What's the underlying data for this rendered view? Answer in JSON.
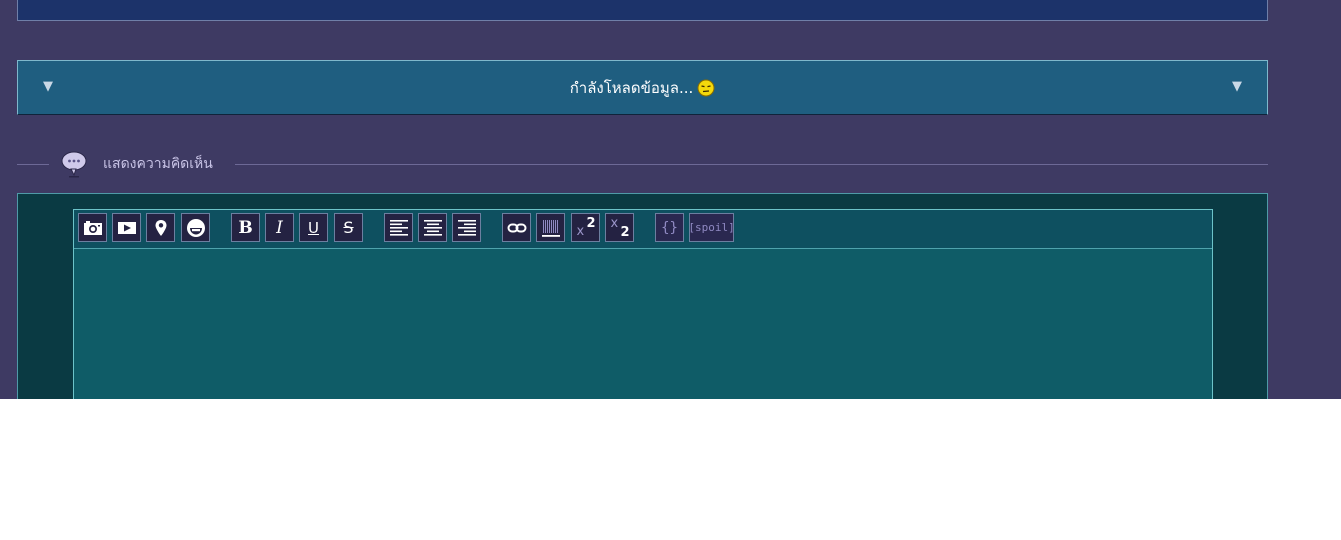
{
  "loading": {
    "text": "กำลังโหลดข้อมูล...",
    "arrow_left": "▼",
    "arrow_right": "▼",
    "icon": "sad-face-emoji-icon"
  },
  "comment": {
    "header_label": "แสดงความคิดเห็น",
    "icon": "speech-bubble-icon"
  },
  "toolbar": {
    "buttons": [
      {
        "name": "insert-image",
        "icon": "camera-icon"
      },
      {
        "name": "insert-video",
        "icon": "video-play-icon"
      },
      {
        "name": "insert-map",
        "icon": "map-pin-icon"
      },
      {
        "name": "insert-emoji",
        "icon": "smiley-icon"
      },
      {
        "name": "bold",
        "label": "B"
      },
      {
        "name": "italic",
        "label": "I"
      },
      {
        "name": "underline",
        "label": "U"
      },
      {
        "name": "strikethrough",
        "label": "S"
      },
      {
        "name": "align-left",
        "icon": "align-left-icon"
      },
      {
        "name": "align-center",
        "icon": "align-center-icon"
      },
      {
        "name": "align-right",
        "icon": "align-right-icon"
      },
      {
        "name": "insert-link",
        "icon": "link-icon"
      },
      {
        "name": "horizontal-rule",
        "icon": "hr-icon"
      },
      {
        "name": "superscript",
        "label_base": "x",
        "label_script": "2"
      },
      {
        "name": "subscript",
        "label_base": "x",
        "label_script": "2"
      },
      {
        "name": "code",
        "label": "{}"
      },
      {
        "name": "spoiler",
        "label": "[spoil]"
      }
    ]
  },
  "editor": {
    "value": ""
  },
  "colors": {
    "page_bg": "#3e3a63",
    "loading_bar": "#1f5e80",
    "editor_bg": "#0f5c67",
    "toolbar_button": "#242242"
  }
}
